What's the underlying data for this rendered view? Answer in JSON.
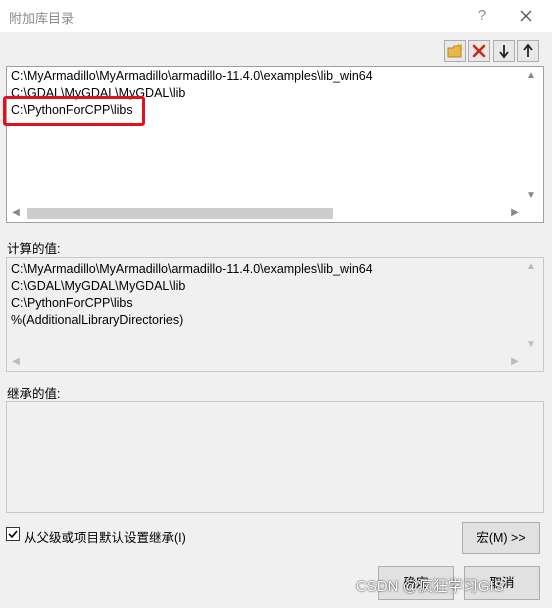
{
  "window": {
    "title": "附加库目录",
    "help_label": "?"
  },
  "toolbar": {
    "new_line_icon": "folder-new-icon",
    "delete_icon": "delete-x-icon",
    "move_down_icon": "arrow-down-icon",
    "move_up_icon": "arrow-up-icon"
  },
  "directories": [
    "C:\\MyArmadillo\\MyArmadillo\\armadillo-11.4.0\\examples\\lib_win64",
    "C:\\GDAL\\MyGDAL\\MyGDAL\\lib",
    "C:\\PythonForCPP\\libs"
  ],
  "evaluated": {
    "label": "计算的值:",
    "lines": [
      "C:\\MyArmadillo\\MyArmadillo\\armadillo-11.4.0\\examples\\lib_win64",
      "C:\\GDAL\\MyGDAL\\MyGDAL\\lib",
      "C:\\PythonForCPP\\libs",
      "%(AdditionalLibraryDirectories)"
    ]
  },
  "inherited": {
    "label": "继承的值:"
  },
  "inherit_checkbox": {
    "label": "从父级或项目默认设置继承(I)",
    "checked": true
  },
  "buttons": {
    "macro": "宏(M) >>",
    "ok": "确定",
    "cancel": "取消"
  },
  "watermark": "CSDN @疯狂学习GIS",
  "colors": {
    "highlight": "#e0121b",
    "delete": "#c42b1c"
  }
}
